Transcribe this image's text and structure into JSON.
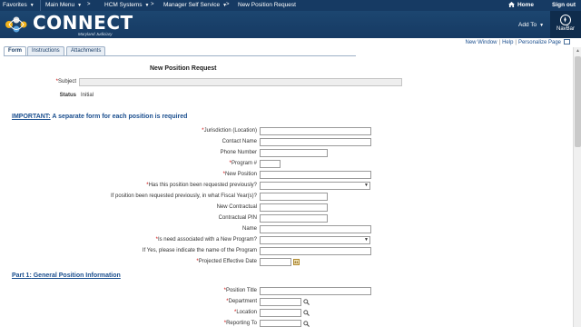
{
  "top_nav": {
    "favorites": "Favorites",
    "main_menu": "Main Menu",
    "hcm_systems": "HCM Systems",
    "manager_self_service": "Manager Self Service",
    "current_page": "New Position Request",
    "home": "Home",
    "sign_out": "Sign out"
  },
  "banner": {
    "logo_text": "CONNECT",
    "logo_sub": "Maryland Judiciary",
    "add_to": "Add To",
    "navbar": "NavBar"
  },
  "page_links": {
    "new_window": "New Window",
    "help": "Help",
    "personalize": "Personalize Page"
  },
  "tabs": [
    "Form",
    "Instructions",
    "Attachments"
  ],
  "form": {
    "title": "New Position Request",
    "subject_label": "Subject",
    "status_label": "Status",
    "status_value": "Initial",
    "important_lead": "IMPORTANT:",
    "important_rest": " A separate form for each position is required",
    "fields": [
      {
        "label": "Jurisdiction (Location)",
        "required": true
      },
      {
        "label": "Contact Name",
        "required": false
      },
      {
        "label": "Phone Number",
        "required": false
      },
      {
        "label": "Program #",
        "required": true
      },
      {
        "label": "New Position",
        "required": true
      },
      {
        "label": "Has this position been requested previously?",
        "required": true
      },
      {
        "label": "If position been requested previously, in what Fiscal Year(s)?",
        "required": false
      },
      {
        "label": "New Contractual",
        "required": false
      },
      {
        "label": "Contractual PIN",
        "required": false
      },
      {
        "label": "Name",
        "required": false
      },
      {
        "label": "Is need associated with a New Program?",
        "required": true
      },
      {
        "label": "If Yes, please indicate the name of the Program",
        "required": false
      },
      {
        "label": "Projected Effective Date",
        "required": true
      }
    ],
    "part1_lead": "Part 1:",
    "part1_rest": " General Position Information",
    "part1_fields": [
      {
        "label": "Position Title",
        "required": true
      },
      {
        "label": "Department",
        "required": true
      },
      {
        "label": "Location",
        "required": true
      },
      {
        "label": "Reporting To",
        "required": true
      }
    ]
  },
  "colors": {
    "nav_bg": "#163a63",
    "link": "#1a4e8e",
    "required": "#cc0000"
  }
}
